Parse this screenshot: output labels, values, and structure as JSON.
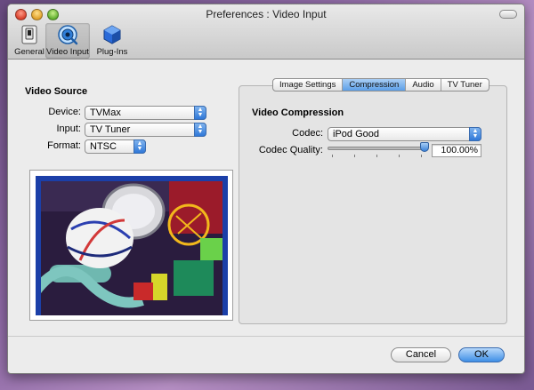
{
  "window": {
    "title": "Preferences : Video Input"
  },
  "toolbar": {
    "items": [
      {
        "label": "General",
        "icon": "general-switch-icon"
      },
      {
        "label": "Video Input",
        "icon": "quicktime-camera-icon"
      },
      {
        "label": "Plug-Ins",
        "icon": "blue-cube-icon"
      }
    ],
    "selected": "Video Input"
  },
  "video_source": {
    "heading": "Video Source",
    "device_label": "Device:",
    "device_value": "TVMax",
    "input_label": "Input:",
    "input_value": "TV Tuner",
    "format_label": "Format:",
    "format_value": "NTSC"
  },
  "tabs": {
    "items": [
      "Image Settings",
      "Compression",
      "Audio",
      "TV Tuner"
    ],
    "active": "Compression"
  },
  "compression": {
    "heading": "Video Compression",
    "codec_label": "Codec:",
    "codec_value": "iPod Good",
    "quality_label": "Codec Quality:",
    "quality_value": "100.00%",
    "quality_fraction": 1.0
  },
  "buttons": {
    "cancel": "Cancel",
    "ok": "OK"
  },
  "colors": {
    "accent": "#3e8fe6",
    "window_bg": "#ececec"
  }
}
